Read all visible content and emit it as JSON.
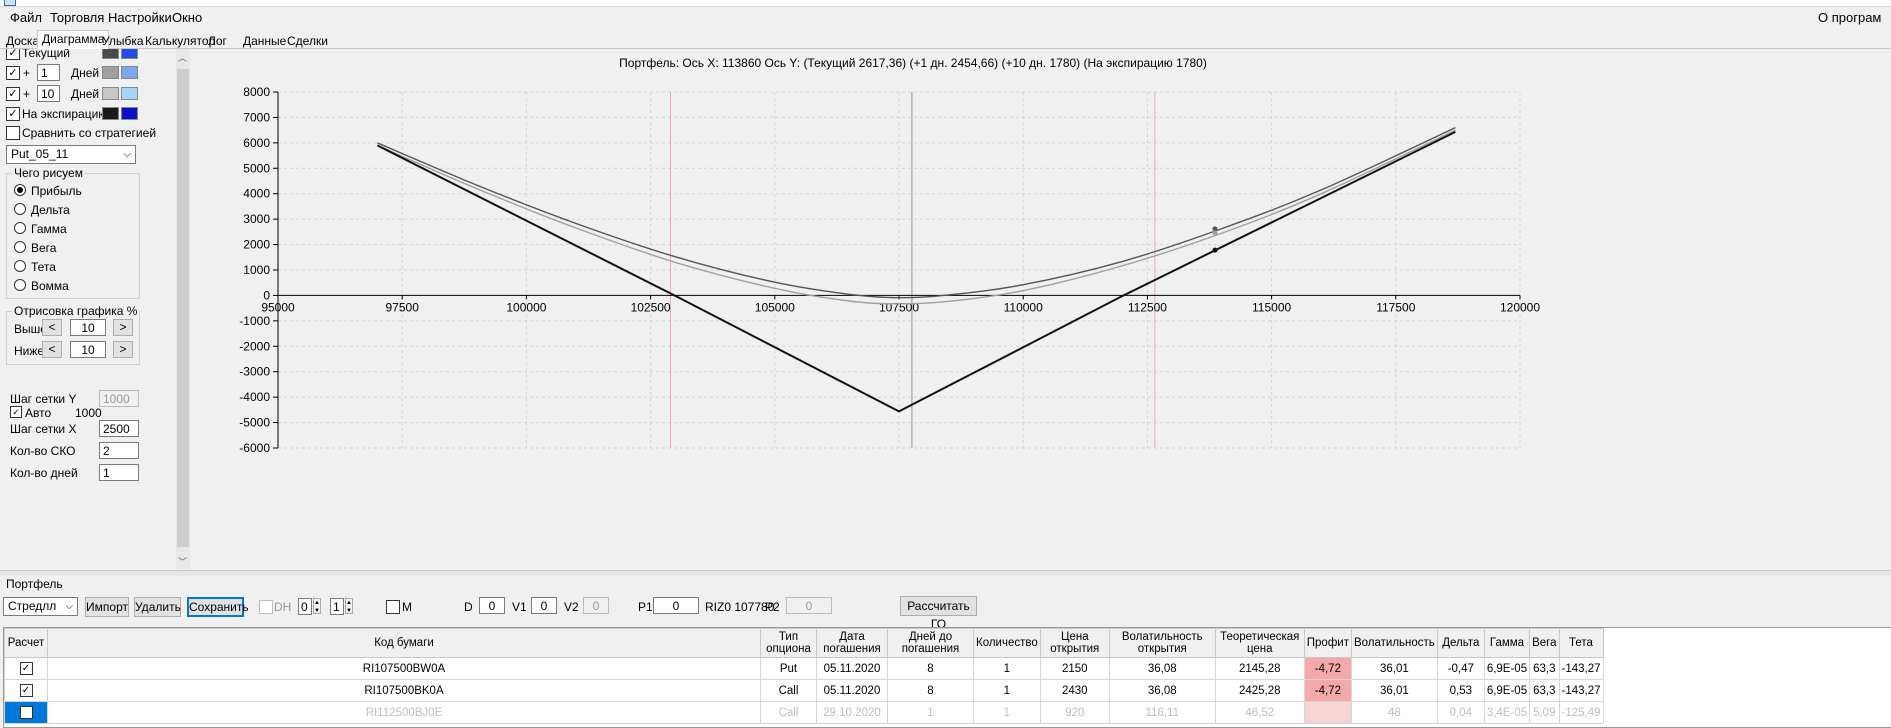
{
  "menu": {
    "file": "Файл",
    "trading": "Торговля",
    "settings": "Настройки",
    "window": "Окно",
    "about": "О програм"
  },
  "tabs": [
    "Доска",
    "Диаграмма",
    "Улыбка",
    "Калькулятор",
    "Лог",
    "Данные",
    "Сделки"
  ],
  "left": {
    "current_label": "Текущий",
    "plus1_sign": "+",
    "plus1_days": "1",
    "days_label": "Дней",
    "plus10_sign": "+",
    "plus10_days": "10",
    "days_label2": "Дней",
    "expiry_label": "На экспирацию",
    "compare_label": "Сравнить со стратегией",
    "strategy_select": "Put_05_11",
    "draw_group_title": "Чего рисуем",
    "radios": [
      "Прибыль",
      "Дельта",
      "Гамма",
      "Вега",
      "Тета",
      "Вомма"
    ],
    "render_group_title": "Отрисовка графика %",
    "above_label": "Выше",
    "above_value": "10",
    "below_label": "Ниже",
    "below_value": "10",
    "left_arrow": "<",
    "right_arrow": ">",
    "grid_y_label": "Шаг сетки Y",
    "grid_y_value": "1000",
    "auto_label": "Авто",
    "auto_value": "1000",
    "grid_x_label": "Шаг сетки X",
    "grid_x_value": "2500",
    "sko_label": "Кол-во СКО",
    "sko_value": "2",
    "days_count_label": "Кол-во дней",
    "days_count_value": "1",
    "colors": {
      "current_1": "#4a4a4a",
      "current_2": "#1f4fe8",
      "plus1_1": "#a0a0a0",
      "plus1_2": "#7aa8f0",
      "plus10_1": "#c8c8c8",
      "plus10_2": "#a8d4f8",
      "expiry_1": "#1a1a1a",
      "expiry_2": "#0a10c8"
    }
  },
  "chart_header": "Портфель: Ось X: 113860 Ось Y:  (Текущий 2617,36)  (+1 дн. 2454,66)  (+10 дн. 1780)  (На экспирацию 1780)",
  "chart_data": {
    "type": "line",
    "xlim": [
      95000,
      120000
    ],
    "ylim": [
      -6000,
      8000
    ],
    "x_ticks": [
      95000,
      97500,
      100000,
      102500,
      105000,
      107500,
      110000,
      112500,
      115000,
      117500,
      120000
    ],
    "y_ticks": [
      8000,
      7000,
      6000,
      5000,
      4000,
      3000,
      2000,
      1000,
      0,
      -1000,
      -2000,
      -3000,
      -4000,
      -5000,
      -6000
    ],
    "grid": true,
    "series": [
      {
        "color": "#555555",
        "x": [
          97000,
          99000,
          101000,
          103000,
          105000,
          106500,
          107500,
          108500,
          110000,
          112000,
          114000,
          116000,
          118700
        ],
        "y": [
          6000,
          4340,
          2830,
          1520,
          520,
          45,
          -90,
          20,
          420,
          1340,
          2630,
          4150,
          6600
        ]
      },
      {
        "color": "#a0a0a0",
        "x": [
          97000,
          99000,
          101000,
          103000,
          105000,
          106500,
          107500,
          108500,
          110000,
          112000,
          114000,
          116000,
          118700
        ],
        "y": [
          5900,
          4200,
          2650,
          1300,
          280,
          -220,
          -330,
          -230,
          190,
          1170,
          2450,
          4000,
          6500
        ]
      },
      {
        "color": "#111111",
        "x": [
          97000,
          103000,
          107500,
          112000,
          118700
        ],
        "y": [
          5900,
          -20,
          -4560,
          -20,
          6430
        ]
      }
    ],
    "markers": [
      {
        "x": 113860,
        "y": 2617.36,
        "color": "#555555"
      },
      {
        "x": 113860,
        "y": 2454.66,
        "color": "#a0a0a0"
      },
      {
        "x": 113860,
        "y": 1780,
        "color": "#111111"
      }
    ],
    "vlines": [
      {
        "x": 102900,
        "color": "#f3a6b4"
      },
      {
        "x": 107760,
        "color": "#8a96a8"
      },
      {
        "x": 112650,
        "color": "#f3a6b4"
      }
    ]
  },
  "portfolio_label": "Портфель",
  "toolbar": {
    "portfolio_select": "Стредлл",
    "import": "Импорт",
    "delete": "Удалить",
    "save": "Сохранить",
    "dh_label": "DH",
    "dh1": "0",
    "dh2": "1",
    "m_label": "M",
    "d_label": "D",
    "d_value": "0",
    "v1_label": "V1",
    "v1_value": "0",
    "v2_label": "V2",
    "v2_value": "0",
    "p1_label": "P1",
    "p1_value": "0",
    "instrument": "RIZ0 107780",
    "p2_label": "P2",
    "p2_value": "0",
    "calc_go": "Рассчитать ГО"
  },
  "table": {
    "headers": [
      "Расчет",
      "Код бумаги",
      "Тип опциона",
      "Дата погашения",
      "Дней до погашения",
      "Количество",
      "Цена открытия",
      "Волатильность открытия",
      "Теоретическая цена",
      "Профит",
      "Волатильность",
      "Дельта",
      "Гамма",
      "Вега",
      "Тета"
    ],
    "rows": [
      {
        "checked": "✓",
        "code": "RI107500BW0A",
        "type": "Put",
        "date": "05.11.2020",
        "days": "8",
        "qty": "1",
        "open": "2150",
        "openvol": "36,08",
        "theo": "2145,28",
        "profit": "-4,72",
        "vol": "36,01",
        "delta": "-0,47",
        "gamma": "6,9E-05",
        "vega": "63,3",
        "theta": "-143,27"
      },
      {
        "checked": "✓",
        "code": "RI107500BK0A",
        "type": "Call",
        "date": "05.11.2020",
        "days": "8",
        "qty": "1",
        "open": "2430",
        "openvol": "36,08",
        "theo": "2425,28",
        "profit": "-4,72",
        "vol": "36,01",
        "delta": "0,53",
        "gamma": "6,9E-05",
        "vega": "63,3",
        "theta": "-143,27"
      },
      {
        "checked": "",
        "code": "RI112500BJ0E",
        "type": "Call",
        "date": "29.10.2020",
        "days": "1",
        "qty": "1",
        "open": "920",
        "openvol": "116,11",
        "theo": "46,52",
        "profit": "",
        "vol": "48",
        "delta": "0,04",
        "gamma": "3,4E-05",
        "vega": "5,09",
        "theta": "-125,49"
      }
    ]
  }
}
